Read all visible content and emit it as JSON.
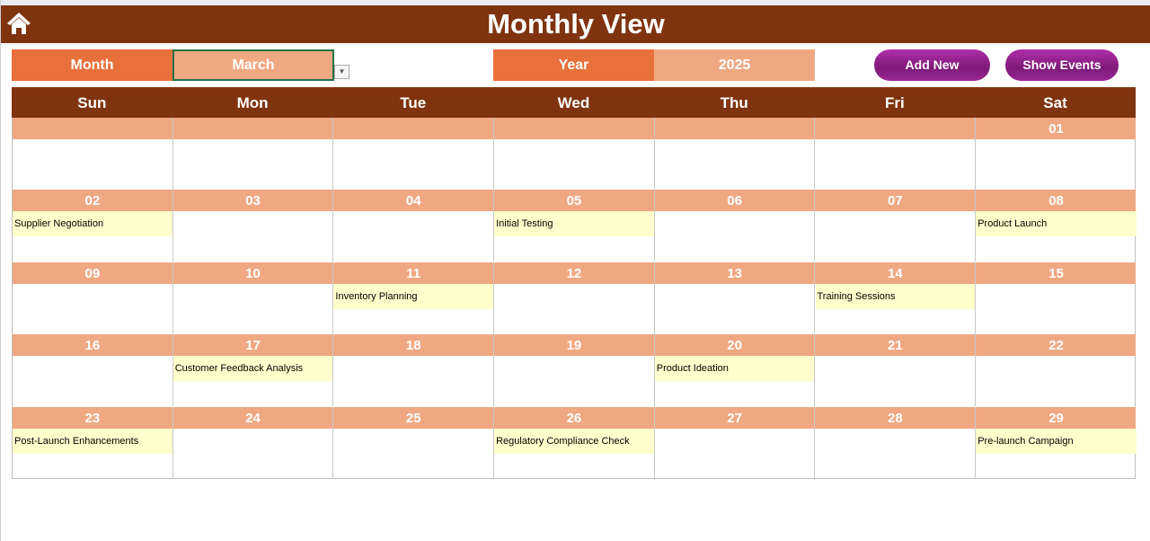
{
  "header": {
    "title": "Monthly View",
    "home_icon": "home-icon"
  },
  "controls": {
    "month_label": "Month",
    "month_value": "March",
    "year_label": "Year",
    "year_value": "2025",
    "add_new": "Add New",
    "show_events": "Show Events"
  },
  "colors": {
    "header": "#7f340f",
    "label": "#e8703a",
    "value": "#f0a882",
    "event": "#ffffcc",
    "button": "#8e2288"
  },
  "weekdays": [
    "Sun",
    "Mon",
    "Tue",
    "Wed",
    "Thu",
    "Fri",
    "Sat"
  ],
  "weeks": [
    {
      "days": [
        "",
        "",
        "",
        "",
        "",
        "",
        "01"
      ],
      "events": [
        "",
        "",
        "",
        "",
        "",
        "",
        ""
      ]
    },
    {
      "days": [
        "02",
        "03",
        "04",
        "05",
        "06",
        "07",
        "08"
      ],
      "events": [
        "Supplier Negotiation",
        "",
        "",
        "Initial Testing",
        "",
        "",
        "Product Launch"
      ]
    },
    {
      "days": [
        "09",
        "10",
        "11",
        "12",
        "13",
        "14",
        "15"
      ],
      "events": [
        "",
        "",
        "Inventory Planning",
        "",
        "",
        "Training Sessions",
        ""
      ]
    },
    {
      "days": [
        "16",
        "17",
        "18",
        "19",
        "20",
        "21",
        "22"
      ],
      "events": [
        "",
        "Customer Feedback Analysis",
        "",
        "",
        "Product Ideation",
        "",
        ""
      ]
    },
    {
      "days": [
        "23",
        "24",
        "25",
        "26",
        "27",
        "28",
        "29"
      ],
      "events": [
        "Post-Launch Enhancements",
        "",
        "",
        "Regulatory Compliance Check",
        "",
        "",
        "Pre-launch Campaign"
      ]
    }
  ]
}
